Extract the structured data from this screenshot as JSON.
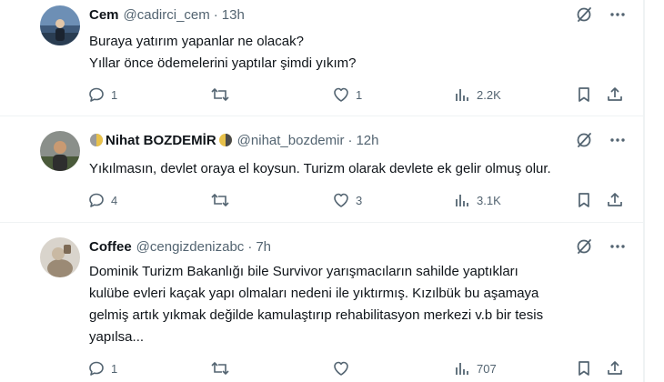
{
  "tweets": [
    {
      "name": "Cem",
      "handle": "@cadirci_cem",
      "sep": "·",
      "time": "13h",
      "lines": [
        "Buraya yatırım yapanlar ne olacak?",
        "Yıllar önce ödemelerini yaptılar şimdi yıkım?"
      ],
      "replies": "1",
      "retweets": "",
      "likes": "1",
      "views": "2.2K"
    },
    {
      "name": "Nihat BOZDEMİR",
      "handle": "@nihat_bozdemir",
      "sep": "·",
      "time": "12h",
      "lines": [
        "Yıkılmasın, devlet oraya el koysun.  Turizm olarak devlete ek gelir olmuş olur."
      ],
      "replies": "4",
      "retweets": "",
      "likes": "3",
      "views": "3.1K"
    },
    {
      "name": "Coffee",
      "handle": "@cengizdenizabc",
      "sep": "·",
      "time": "7h",
      "lines": [
        "Dominik Turizm Bakanlığı bile Survivor yarışmacıların sahilde yaptıkları",
        "kulübe evleri kaçak yapı olmaları nedeni ile yıktırmış. Kızılbük bu aşamaya",
        "gelmiş artık yıkmak değilde kamulaştırıp rehabilitasyon merkezi v.b bir tesis",
        "yapılsa..."
      ],
      "replies": "1",
      "retweets": "",
      "likes": "",
      "views": "707"
    }
  ]
}
